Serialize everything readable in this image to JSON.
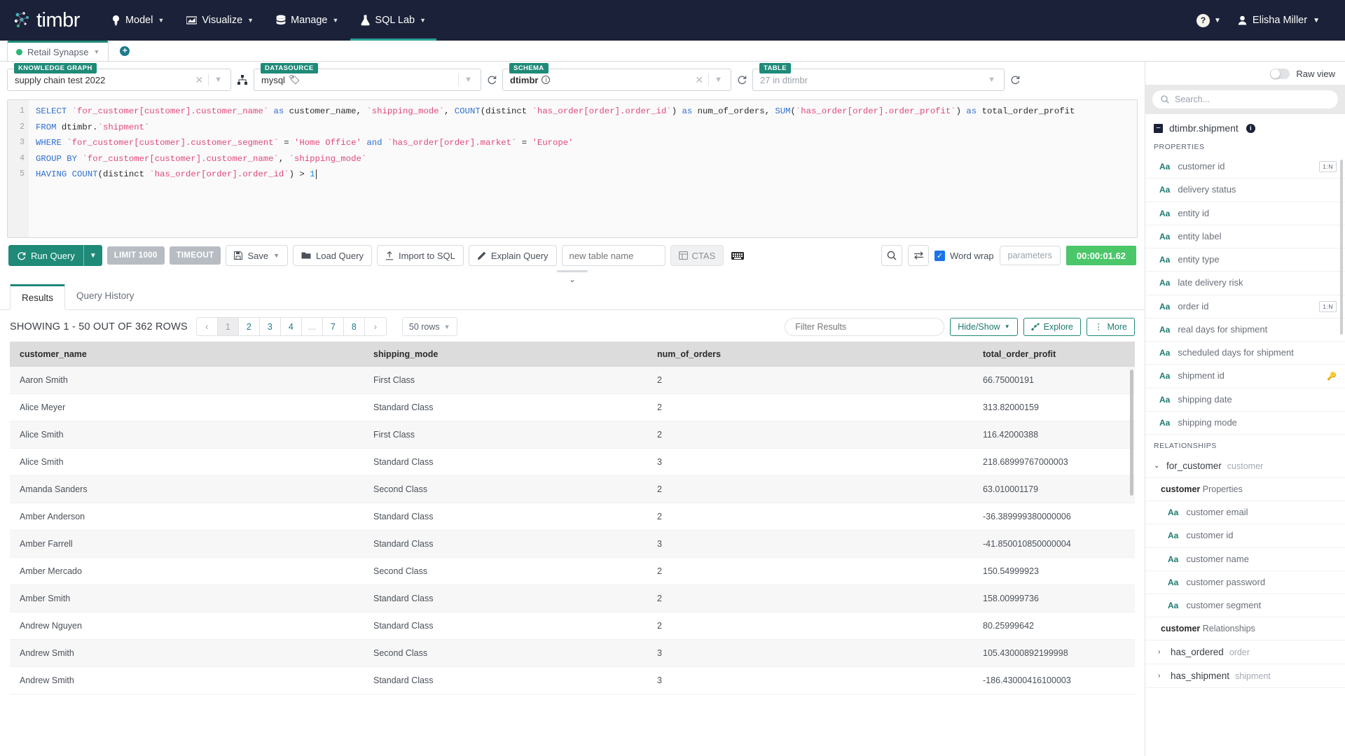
{
  "topnav": {
    "brand": "timbr",
    "items": [
      {
        "label": "Model",
        "icon": "lightbulb-icon"
      },
      {
        "label": "Visualize",
        "icon": "chart-icon"
      },
      {
        "label": "Manage",
        "icon": "database-icon"
      },
      {
        "label": "SQL Lab",
        "icon": "flask-icon"
      }
    ],
    "help_icon": "help-icon",
    "user_name": "Elisha Miller"
  },
  "tabbar": {
    "tab_label": "Retail Synapse",
    "add_tab_label": "+"
  },
  "selectors": {
    "knowledge_graph": {
      "label": "KNOWLEDGE GRAPH",
      "value": "supply chain test 2022"
    },
    "datasource": {
      "label": "DATASOURCE",
      "value": "mysql"
    },
    "schema": {
      "label": "SCHEMA",
      "value": "dtimbr"
    },
    "table": {
      "label": "TABLE",
      "value": "27 in dtimbr"
    }
  },
  "editor": {
    "line_numbers": [
      "1",
      "2",
      "3",
      "4",
      "5"
    ],
    "sql": "SELECT `for_customer[customer].customer_name` as customer_name, `shipping_mode`, COUNT(distinct `has_order[order].order_id`) as num_of_orders, SUM(`has_order[order].order_profit`) as total_order_profit\nFROM dtimbr.`shipment`\nWHERE `for_customer[customer].customer_segment` = 'Home Office' and `has_order[order].market` = 'Europe'\nGROUP BY `for_customer[customer].customer_name`, `shipping_mode`\nHAVING COUNT(distinct `has_order[order].order_id`) > 1"
  },
  "toolbar": {
    "run_query": "Run Query",
    "limit": "LIMIT 1000",
    "timeout": "TIMEOUT",
    "save": "Save",
    "load_query": "Load Query",
    "import_to_sql": "Import to SQL",
    "explain_query": "Explain Query",
    "new_table_placeholder": "new table name",
    "ctas": "CTAS",
    "word_wrap": "Word wrap",
    "parameters": "parameters",
    "timer": "00:00:01.62"
  },
  "results": {
    "tabs": [
      {
        "label": "Results",
        "active": true
      },
      {
        "label": "Query History",
        "active": false
      }
    ],
    "showing": "SHOWING 1 - 50 OUT OF 362 ROWS",
    "pages": [
      "‹",
      "1",
      "2",
      "3",
      "4",
      "...",
      "7",
      "8",
      "›"
    ],
    "current_page": "1",
    "rows_per_page": "50 rows",
    "filter_placeholder": "Filter Results",
    "hide_show": "Hide/Show",
    "explore": "Explore",
    "more": "More",
    "columns": [
      "customer_name",
      "shipping_mode",
      "num_of_orders",
      "total_order_profit"
    ],
    "rows": [
      [
        "Aaron Smith",
        "First Class",
        "2",
        "66.75000191"
      ],
      [
        "Alice Meyer",
        "Standard Class",
        "2",
        "313.82000159"
      ],
      [
        "Alice Smith",
        "First Class",
        "2",
        "116.42000388"
      ],
      [
        "Alice Smith",
        "Standard Class",
        "3",
        "218.68999767000003"
      ],
      [
        "Amanda Sanders",
        "Second Class",
        "2",
        "63.010001179"
      ],
      [
        "Amber Anderson",
        "Standard Class",
        "2",
        "-36.389999380000006"
      ],
      [
        "Amber Farrell",
        "Standard Class",
        "3",
        "-41.850010850000004"
      ],
      [
        "Amber Mercado",
        "Second Class",
        "2",
        "150.54999923"
      ],
      [
        "Amber Smith",
        "Standard Class",
        "2",
        "158.00999736"
      ],
      [
        "Andrew Nguyen",
        "Standard Class",
        "2",
        "80.25999642"
      ],
      [
        "Andrew Smith",
        "Second Class",
        "3",
        "105.43000892199998"
      ],
      [
        "Andrew Smith",
        "Standard Class",
        "3",
        "-186.43000416100003"
      ]
    ]
  },
  "sidebar": {
    "raw_view": "Raw view",
    "search_placeholder": "Search...",
    "tree_title": "dtimbr.shipment",
    "properties_label": "PROPERTIES",
    "properties": [
      {
        "name": "customer id",
        "badge": "1:N"
      },
      {
        "name": "delivery status",
        "badge": ""
      },
      {
        "name": "entity id",
        "badge": ""
      },
      {
        "name": "entity label",
        "badge": ""
      },
      {
        "name": "entity type",
        "badge": ""
      },
      {
        "name": "late delivery risk",
        "badge": ""
      },
      {
        "name": "order id",
        "badge": "1:N"
      },
      {
        "name": "real days for shipment",
        "badge": ""
      },
      {
        "name": "scheduled days for shipment",
        "badge": ""
      },
      {
        "name": "shipment id",
        "badge": "",
        "key": true
      },
      {
        "name": "shipping date",
        "badge": ""
      },
      {
        "name": "shipping mode",
        "badge": ""
      }
    ],
    "relationships_label": "RELATIONSHIPS",
    "relationship": {
      "name": "for_customer",
      "type": "customer",
      "expanded": true
    },
    "sub_properties_head_bold": "customer",
    "sub_properties_head_rest": " Properties",
    "sub_properties": [
      "customer email",
      "customer id",
      "customer name",
      "customer password",
      "customer segment"
    ],
    "sub_relationships_head_bold": "customer",
    "sub_relationships_head_rest": " Relationships",
    "sub_relationships": [
      {
        "name": "has_ordered",
        "type": "order"
      },
      {
        "name": "has_shipment",
        "type": "shipment"
      }
    ]
  },
  "colors": {
    "nav_bg": "#1b2138",
    "teal": "#1f8a78",
    "green_timer": "#4bc76a",
    "blue_check": "#1a73e8"
  }
}
